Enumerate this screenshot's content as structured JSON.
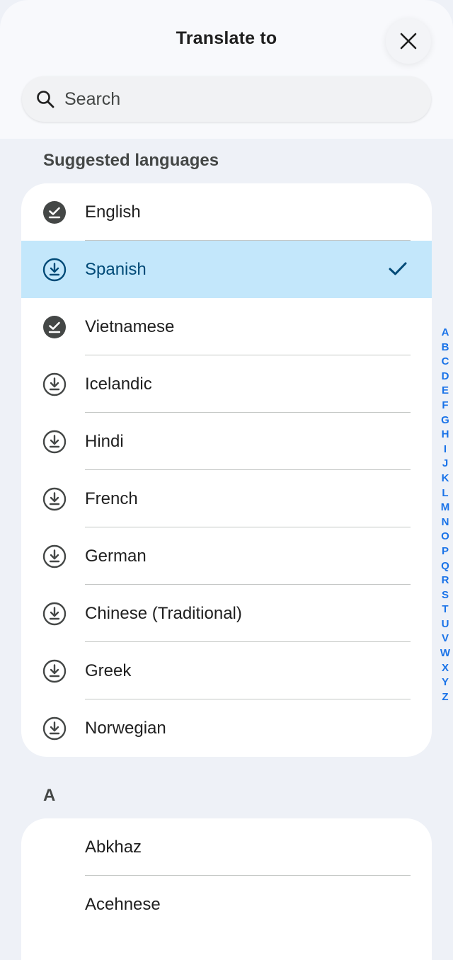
{
  "header": {
    "title": "Translate to",
    "close_icon": "close-icon"
  },
  "search": {
    "placeholder": "Search",
    "value": ""
  },
  "suggested": {
    "label": "Suggested languages",
    "items": [
      {
        "label": "English",
        "icon": "downloaded-icon",
        "selected": false
      },
      {
        "label": "Spanish",
        "icon": "download-icon",
        "selected": true
      },
      {
        "label": "Vietnamese",
        "icon": "downloaded-icon",
        "selected": false
      },
      {
        "label": "Icelandic",
        "icon": "download-icon",
        "selected": false
      },
      {
        "label": "Hindi",
        "icon": "download-icon",
        "selected": false
      },
      {
        "label": "French",
        "icon": "download-icon",
        "selected": false
      },
      {
        "label": "German",
        "icon": "download-icon",
        "selected": false
      },
      {
        "label": "Chinese (Traditional)",
        "icon": "download-icon",
        "selected": false
      },
      {
        "label": "Greek",
        "icon": "download-icon",
        "selected": false
      },
      {
        "label": "Norwegian",
        "icon": "download-icon",
        "selected": false
      }
    ]
  },
  "section_a": {
    "label": "A",
    "items": [
      {
        "label": "Abkhaz"
      },
      {
        "label": "Acehnese"
      }
    ]
  },
  "alphabet_index": [
    "A",
    "B",
    "C",
    "D",
    "E",
    "F",
    "G",
    "H",
    "I",
    "J",
    "K",
    "L",
    "M",
    "N",
    "O",
    "P",
    "Q",
    "R",
    "S",
    "T",
    "U",
    "V",
    "W",
    "X",
    "Y",
    "Z"
  ],
  "colors": {
    "selected_bg": "#c3e7fb",
    "selected_text": "#004a77",
    "index_letters": "#1a73e8",
    "page_bg": "#eef1f7"
  }
}
